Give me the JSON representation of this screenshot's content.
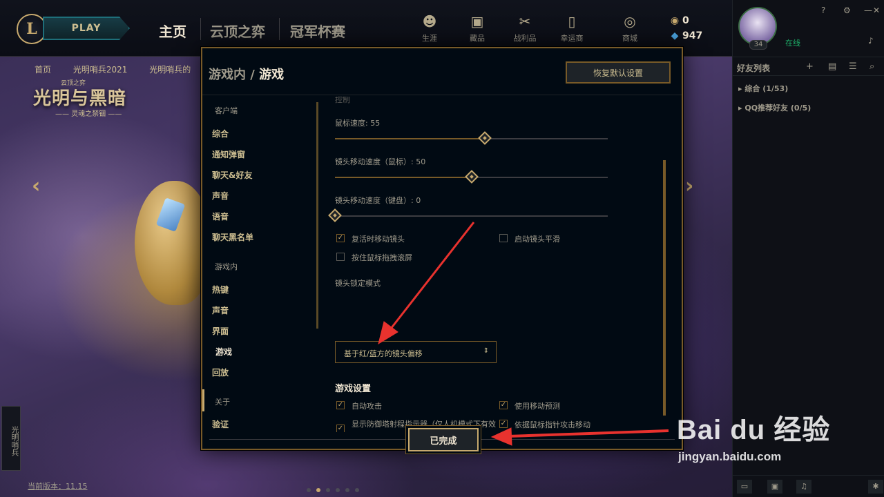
{
  "topbar": {
    "logo": "L",
    "play_label": "PLAY",
    "tabs": [
      "主页",
      "云顶之弈",
      "冠军杯赛"
    ],
    "icons": [
      {
        "label": "生涯",
        "icon": "profile-icon"
      },
      {
        "label": "藏品",
        "icon": "collection-icon"
      },
      {
        "label": "战利品",
        "icon": "loot-icon"
      },
      {
        "label": "幸运商店",
        "icon": "lucky-store-icon"
      },
      {
        "label": "商城",
        "icon": "store-icon"
      }
    ],
    "currency": {
      "rp": "0",
      "be": "947"
    }
  },
  "subnav": [
    "首页",
    "光明哨兵2021",
    "光明哨兵的"
  ],
  "splash": {
    "small": "云顶之弈",
    "title": "光明与黑暗",
    "sub": "—— 灵魂之禁锢 ——"
  },
  "side_tab": "光明哨兵",
  "version": "当前版本：11.15",
  "social": {
    "level": "34",
    "status": "在线",
    "friends_title": "好友列表",
    "groups": [
      "综合 (1/53)",
      "QQ推荐好友 (0/5)"
    ]
  },
  "modal": {
    "crumb": "游戏内",
    "sep": "/",
    "title": "游戏",
    "restore_label": "恢复默认设置",
    "done_label": "已完成",
    "nav": {
      "section_client": "客户端",
      "client_items": [
        "综合",
        "通知弹窗",
        "聊天&好友",
        "声音",
        "语音",
        "聊天黑名单"
      ],
      "section_ingame": "游戏内",
      "ingame_items": [
        "热键",
        "声音",
        "界面",
        "游戏",
        "回放"
      ],
      "about": "关于",
      "verify": "验证"
    },
    "content": {
      "cut_heading": "控制",
      "sliders": [
        {
          "label": "鼠标速度: 55",
          "value": 55
        },
        {
          "label": "镜头移动速度（鼠标）: 50",
          "value": 50
        },
        {
          "label": "镜头移动速度（键盘）: 0",
          "value": 0
        }
      ],
      "checks": [
        {
          "label": "复活时移动镜头",
          "checked": true
        },
        {
          "label": "启动镜头平滑",
          "checked": false
        },
        {
          "label": "按住鼠标拖拽滚屏",
          "checked": false
        }
      ],
      "lock_mode_label": "镜头锁定模式",
      "lock_mode_value": "基于红/蓝方的镜头偏移",
      "game_section": "游戏设置",
      "game_checks": [
        {
          "label": "自动攻击",
          "checked": true
        },
        {
          "label": "使用移动预测",
          "checked": true
        },
        {
          "label": "显示防御塔射程指示器（仅人机模式下有效",
          "checked": true
        },
        {
          "label": "依据鼠标指针攻击移动",
          "checked": true
        }
      ]
    }
  },
  "watermark": {
    "main": "Bai du 经验",
    "url": "jingyan.baidu.com"
  },
  "colors": {
    "gold": "#c8aa6e",
    "dark_gold": "#785a28",
    "bg": "#010a13",
    "annotation": "#e8322e"
  }
}
